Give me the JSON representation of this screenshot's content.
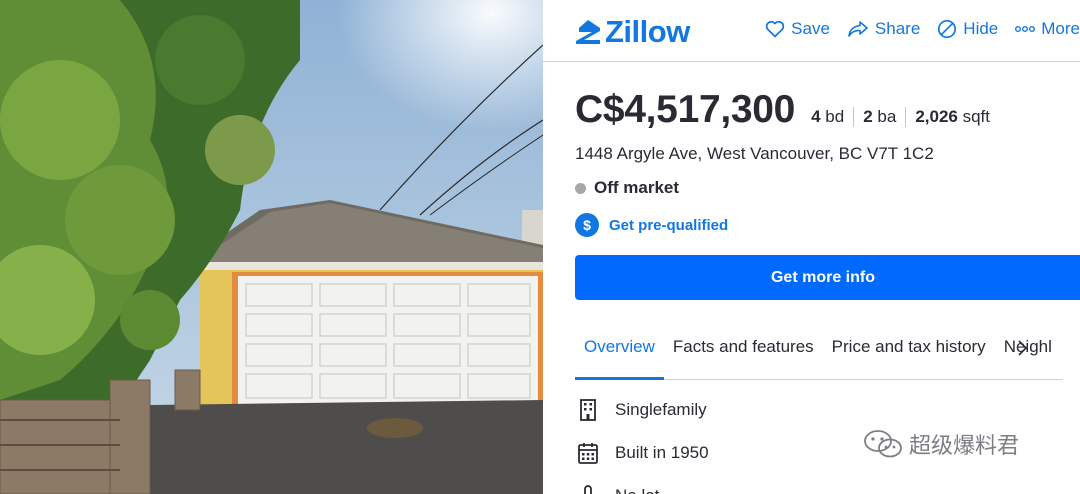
{
  "brand": {
    "name": "Zillow",
    "color": "#1277e1"
  },
  "header_actions": [
    {
      "label": "Save",
      "icon": "heart-icon"
    },
    {
      "label": "Share",
      "icon": "share-icon"
    },
    {
      "label": "Hide",
      "icon": "hide-icon"
    },
    {
      "label": "More",
      "icon": "more-icon"
    }
  ],
  "listing": {
    "price": "C$4,517,300",
    "beds": "4",
    "beds_unit": "bd",
    "baths": "2",
    "baths_unit": "ba",
    "sqft": "2,026",
    "sqft_unit": "sqft",
    "address": "1448 Argyle Ave, West Vancouver, BC V7T 1C2",
    "status": "Off market",
    "prequal_label": "Get pre-qualified",
    "cta_label": "Get more info"
  },
  "tabs": [
    {
      "label": "Overview",
      "active": true
    },
    {
      "label": "Facts and features",
      "active": false
    },
    {
      "label": "Price and tax history",
      "active": false
    },
    {
      "label": "Neighl",
      "active": false
    }
  ],
  "features": [
    {
      "label": "Singlefamily",
      "icon": "building-icon"
    },
    {
      "label": "Built in 1950",
      "icon": "calendar-icon"
    },
    {
      "label": "No lot",
      "icon": "lot-icon"
    }
  ],
  "watermark": "超级爆料君",
  "colors": {
    "cta": "#006aff",
    "status_dot": "#a7a6ab",
    "text": "#2a2a33"
  }
}
